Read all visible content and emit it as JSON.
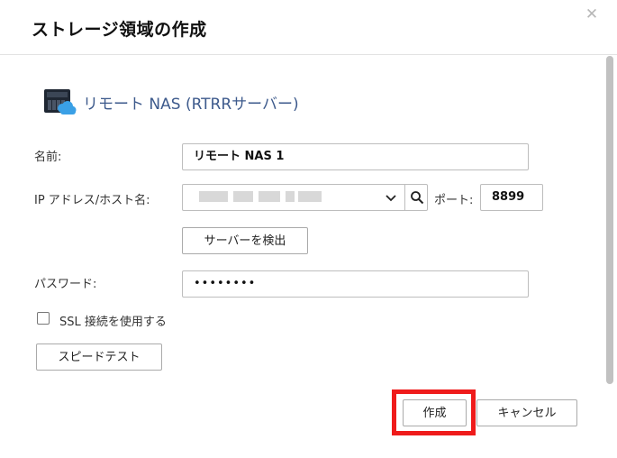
{
  "dialog": {
    "title": "ストレージ領域の作成",
    "close_icon": "close-icon"
  },
  "header": {
    "icon": "nas-cloud-icon",
    "title": "リモート NAS (RTRRサーバー)"
  },
  "form": {
    "name_label": "名前:",
    "name_value": "リモート NAS 1",
    "ip_label": "IP アドレス/ホスト名:",
    "ip_value": "",
    "port_label": "ポート:",
    "port_value": "8899",
    "detect_button": "サーバーを検出",
    "password_label": "パスワード:",
    "password_value": "••••••••",
    "ssl_label": "SSL 接続を使用する",
    "ssl_checked": false,
    "speed_test_button": "スピードテスト"
  },
  "footer": {
    "create_button": "作成",
    "cancel_button": "キャンセル"
  },
  "colors": {
    "title_accent": "#3d5a8c",
    "highlight": "#ef1b1b",
    "cloud": "#3aa0e6"
  }
}
